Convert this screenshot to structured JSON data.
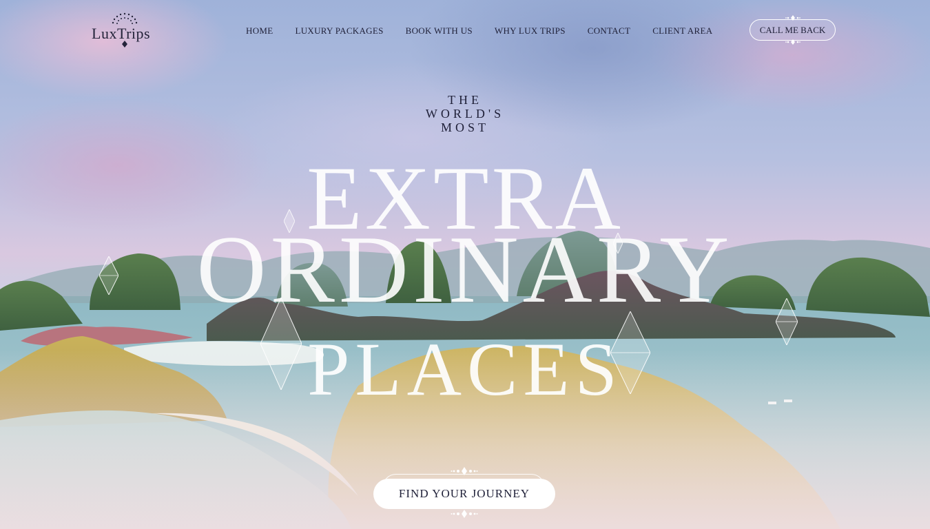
{
  "brand": {
    "logo_text": "LuxTrips"
  },
  "nav": {
    "items": [
      {
        "label": "HOME"
      },
      {
        "label": "LUXURY PACKAGES"
      },
      {
        "label": "BOOK WITH US"
      },
      {
        "label": "WHY LUX TRIPS"
      },
      {
        "label": "CONTACT"
      },
      {
        "label": "CLIENT AREA"
      }
    ]
  },
  "header": {
    "call_button_label": "CALL ME BACK"
  },
  "hero": {
    "line1": "THE",
    "line2": "WORLD'S",
    "line3": "MOST",
    "big1": "EXTRA",
    "big2": "ORDINARY",
    "big3": "PLACES",
    "cta_label": "FIND YOUR JOURNEY"
  },
  "colors": {
    "text_dark": "#1f2038",
    "hero_text": "#ffffff",
    "button_bg": "#ffffff"
  }
}
